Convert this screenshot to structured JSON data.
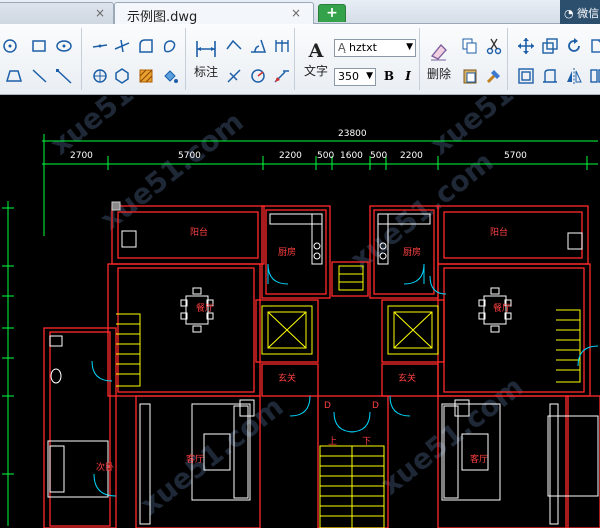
{
  "tabs": {
    "close_glyph": "×",
    "active_label": "示例图.dwg",
    "new_tab_glyph": "+",
    "right_label": "微信"
  },
  "ribbon": {
    "annotate_label": "标注",
    "text_label": "文字",
    "delete_label": "删除",
    "font_name": "hztxt",
    "font_size": "350",
    "bold_label": "B",
    "italic_label": "I"
  },
  "drawing": {
    "overall_dimension": "23800",
    "segment_dimensions": [
      "2700",
      "5700",
      "2200",
      "500",
      "1600",
      "500",
      "2200",
      "5700"
    ],
    "room_labels": {
      "balcony": "阳台",
      "kitchen": "厨房",
      "dining": "餐厅",
      "entry": "玄关",
      "bedroom": "次卧",
      "living": "客厅"
    },
    "stair_up": "上",
    "stair_down": "下",
    "door_code": "D",
    "watermark": "xue51.com"
  },
  "colors": {
    "canvas": "#000000",
    "wall": "#ff2a2a",
    "dimension": "#00ff3c",
    "furniture": "#ffffff",
    "door": "#00d7ff",
    "stairs": "#ffff00",
    "active_tab": "#f3f6fa",
    "new_tab": "#33a24a"
  }
}
